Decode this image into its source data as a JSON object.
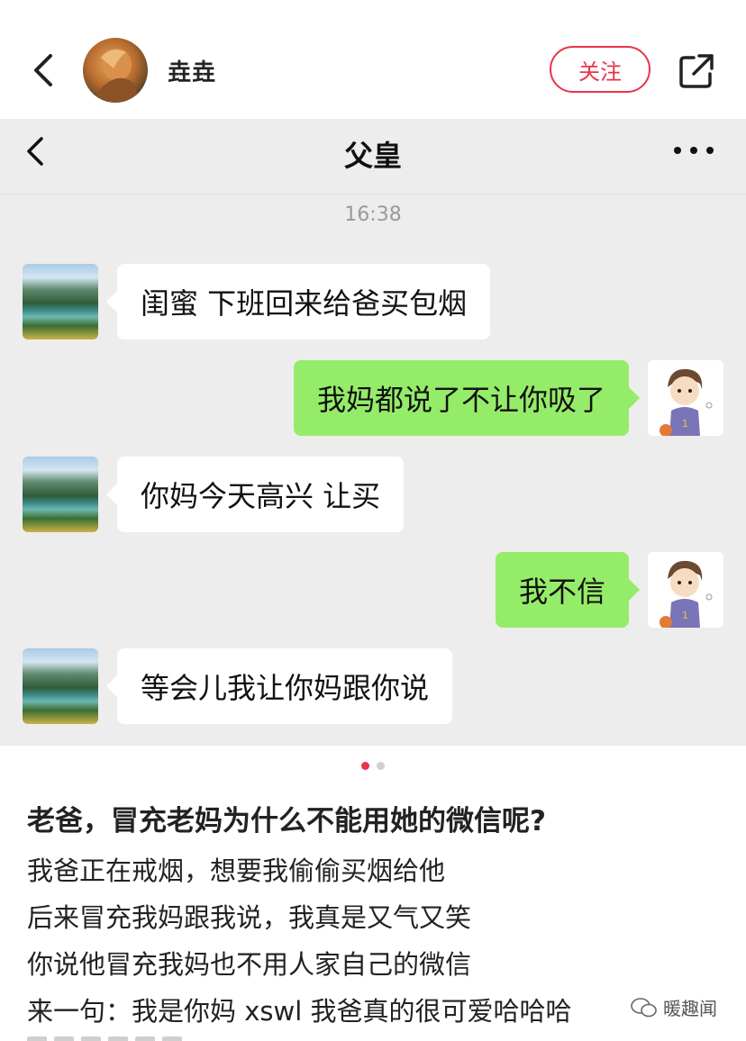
{
  "header": {
    "author_name": "垚垚",
    "follow_label": "关注"
  },
  "chat": {
    "title": "父皇",
    "time": "16:38",
    "messages": [
      {
        "side": "left",
        "text": "闺蜜 下班回来给爸买包烟"
      },
      {
        "side": "right",
        "text": "我妈都说了不让你吸了"
      },
      {
        "side": "left",
        "text": "你妈今天高兴 让买"
      },
      {
        "side": "right",
        "text": "我不信"
      },
      {
        "side": "left",
        "text": "等会儿我让你妈跟你说"
      }
    ]
  },
  "pagination": {
    "current": 1,
    "total": 2
  },
  "post": {
    "title": "老爸，冒充老妈为什么不能用她的微信呢?",
    "lines": [
      "我爸正在戒烟，想要我偷偷买烟给他",
      "后来冒充我妈跟我说，我真是又气又笑",
      "你说他冒充我妈也不用人家自己的微信",
      "来一句：我是你妈 xswl 我爸真的很可爱哈哈哈"
    ]
  },
  "watermark": {
    "text": "暖趣闻"
  },
  "colors": {
    "accent": "#e8334a",
    "bubble_green": "#95ec69",
    "chat_bg": "#ededed"
  }
}
